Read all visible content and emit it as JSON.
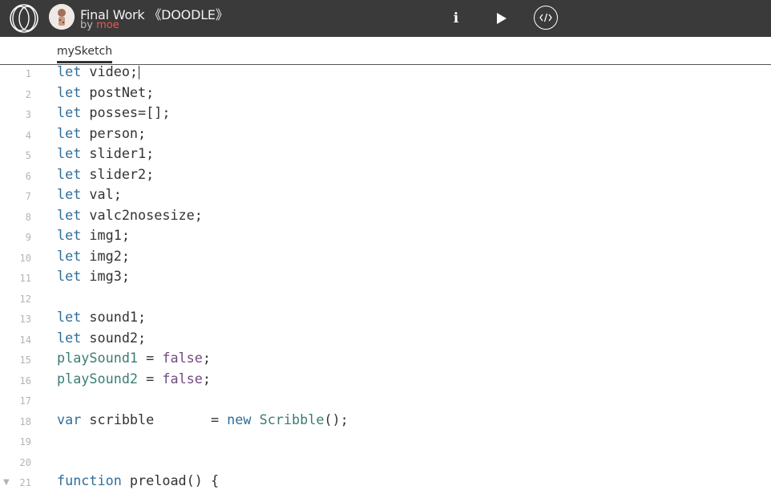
{
  "header": {
    "title": "Final Work 《DOODLE》",
    "by_prefix": "by ",
    "author": "moe",
    "info_label": "i",
    "icons": [
      "p5-logo-icon",
      "avatar",
      "info-icon",
      "play-icon",
      "code-view-icon"
    ]
  },
  "tabs": [
    {
      "label": "mySketch",
      "active": true
    }
  ],
  "editor": {
    "lines": [
      {
        "num": "1",
        "tokens": [
          [
            "kw",
            "let"
          ],
          [
            "p",
            " video;"
          ]
        ]
      },
      {
        "num": "2",
        "tokens": [
          [
            "kw",
            "let"
          ],
          [
            "p",
            " postNet;"
          ]
        ]
      },
      {
        "num": "3",
        "tokens": [
          [
            "kw",
            "let"
          ],
          [
            "p",
            " posses=[];"
          ]
        ]
      },
      {
        "num": "4",
        "tokens": [
          [
            "kw",
            "let"
          ],
          [
            "p",
            " person;"
          ]
        ]
      },
      {
        "num": "5",
        "tokens": [
          [
            "kw",
            "let"
          ],
          [
            "p",
            " slider1;"
          ]
        ]
      },
      {
        "num": "6",
        "tokens": [
          [
            "kw",
            "let"
          ],
          [
            "p",
            " slider2;"
          ]
        ]
      },
      {
        "num": "7",
        "tokens": [
          [
            "kw",
            "let"
          ],
          [
            "p",
            " val;"
          ]
        ]
      },
      {
        "num": "8",
        "tokens": [
          [
            "kw",
            "let"
          ],
          [
            "p",
            " valc2nosesize;"
          ]
        ]
      },
      {
        "num": "9",
        "tokens": [
          [
            "kw",
            "let"
          ],
          [
            "p",
            " img1;"
          ]
        ]
      },
      {
        "num": "10",
        "tokens": [
          [
            "kw",
            "let"
          ],
          [
            "p",
            " img2;"
          ]
        ]
      },
      {
        "num": "11",
        "tokens": [
          [
            "kw",
            "let"
          ],
          [
            "p",
            " img3;"
          ]
        ]
      },
      {
        "num": "12",
        "tokens": []
      },
      {
        "num": "13",
        "tokens": [
          [
            "kw",
            "let"
          ],
          [
            "p",
            " sound1;"
          ]
        ]
      },
      {
        "num": "14",
        "tokens": [
          [
            "kw",
            "let"
          ],
          [
            "p",
            " sound2;"
          ]
        ]
      },
      {
        "num": "15",
        "tokens": [
          [
            "def",
            "playSound1"
          ],
          [
            "p",
            " = "
          ],
          [
            "bool",
            "false"
          ],
          [
            "p",
            ";"
          ]
        ]
      },
      {
        "num": "16",
        "tokens": [
          [
            "def",
            "playSound2"
          ],
          [
            "p",
            " = "
          ],
          [
            "bool",
            "false"
          ],
          [
            "p",
            ";"
          ]
        ]
      },
      {
        "num": "17",
        "tokens": []
      },
      {
        "num": "18",
        "tokens": [
          [
            "kw",
            "var"
          ],
          [
            "p",
            " scribble       = "
          ],
          [
            "kw",
            "new"
          ],
          [
            "p",
            " "
          ],
          [
            "def",
            "Scribble"
          ],
          [
            "p",
            "();"
          ]
        ]
      },
      {
        "num": "19",
        "tokens": []
      },
      {
        "num": "20",
        "tokens": []
      },
      {
        "num": "21",
        "fold": "▼",
        "tokens": [
          [
            "kw",
            "function"
          ],
          [
            "p",
            " preload() {"
          ]
        ]
      }
    ]
  },
  "colors": {
    "topbar_bg": "#3a3a3a",
    "author": "#ea5a4d",
    "keyword": "#2f6e9b",
    "identifier_def": "#3a7d72",
    "boolean": "#714b80"
  }
}
